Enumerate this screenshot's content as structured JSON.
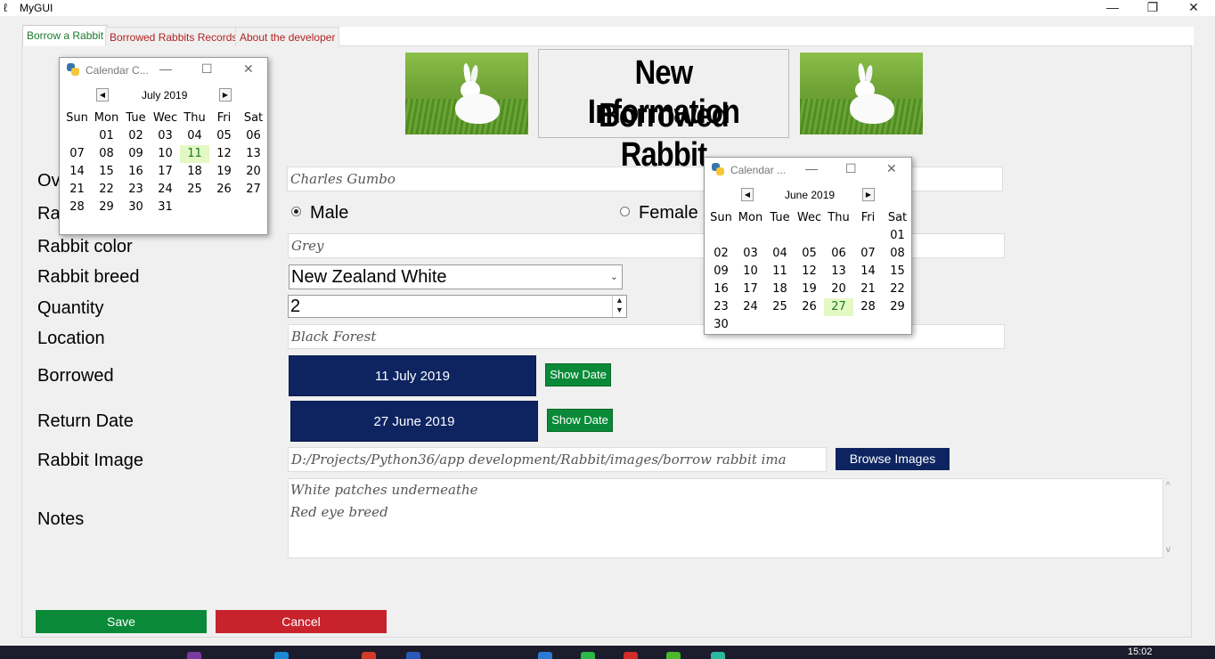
{
  "window": {
    "title": "MyGUI",
    "minimize": "—",
    "restore": "❐",
    "close": "✕",
    "app_icon": "feather-icon"
  },
  "tabs": [
    {
      "label": "Borrow a Rabbit",
      "active": true
    },
    {
      "label": "Borrowed Rabbits Records",
      "active": false
    },
    {
      "label": "About the developer",
      "active": false
    }
  ],
  "header": {
    "line1": "New Information",
    "line2": "Borrowed Rabbit"
  },
  "form": {
    "owner_label": "Ov",
    "owner_value": "Charles Gumbo",
    "rabbit_sex_label": "Ra",
    "sex_options": [
      "Male",
      "Female"
    ],
    "sex_selected": "Male",
    "color_label": "Rabbit color",
    "color_value": "Grey",
    "breed_label": "Rabbit breed",
    "breed_value": "New Zealand White",
    "quantity_label": "Quantity",
    "quantity_value": "2",
    "location_label": "Location",
    "location_value": "Black Forest",
    "borrowed_label": "Borrowed",
    "borrowed_date": "11 July 2019",
    "return_label": "Return Date",
    "return_date": "27 June 2019",
    "show_date_label": "Show Date",
    "image_label": "Rabbit Image",
    "image_path": "D:/Projects/Python36/app development/Rabbit/images/borrow rabbit ima",
    "browse_label": "Browse Images",
    "notes_label": "Notes",
    "notes_line1": "White patches underneathe",
    "notes_line2": "Red eye breed"
  },
  "buttons": {
    "save": "Save",
    "cancel": "Cancel"
  },
  "calendar_july": {
    "title": "Calendar C...",
    "month": "July 2019",
    "days": [
      "Sun",
      "Mon",
      "Tue",
      "Wec",
      "Thu",
      "Fri",
      "Sat"
    ],
    "weeks": [
      [
        "",
        "01",
        "02",
        "03",
        "04",
        "05",
        "06"
      ],
      [
        "07",
        "08",
        "09",
        "10",
        "11",
        "12",
        "13"
      ],
      [
        "14",
        "15",
        "16",
        "17",
        "18",
        "19",
        "20"
      ],
      [
        "21",
        "22",
        "23",
        "24",
        "25",
        "26",
        "27"
      ],
      [
        "28",
        "29",
        "30",
        "31",
        "",
        "",
        ""
      ]
    ],
    "selected": "11"
  },
  "calendar_june": {
    "title": "Calendar ...",
    "month": "June 2019",
    "days": [
      "Sun",
      "Mon",
      "Tue",
      "Wec",
      "Thu",
      "Fri",
      "Sat"
    ],
    "weeks": [
      [
        "",
        "",
        "",
        "",
        "",
        "",
        "01"
      ],
      [
        "02",
        "03",
        "04",
        "05",
        "06",
        "07",
        "08"
      ],
      [
        "09",
        "10",
        "11",
        "12",
        "13",
        "14",
        "15"
      ],
      [
        "16",
        "17",
        "18",
        "19",
        "20",
        "21",
        "22"
      ],
      [
        "23",
        "24",
        "25",
        "26",
        "27",
        "28",
        "29"
      ],
      [
        "30",
        "",
        "",
        "",
        "",
        "",
        ""
      ]
    ],
    "selected": "27"
  },
  "taskbar": {
    "clock": "15:02"
  },
  "colors": {
    "save": "#0a8a38",
    "cancel": "#c8232c",
    "date_button": "#0d2461",
    "selected_day": "#e4f8c4"
  }
}
